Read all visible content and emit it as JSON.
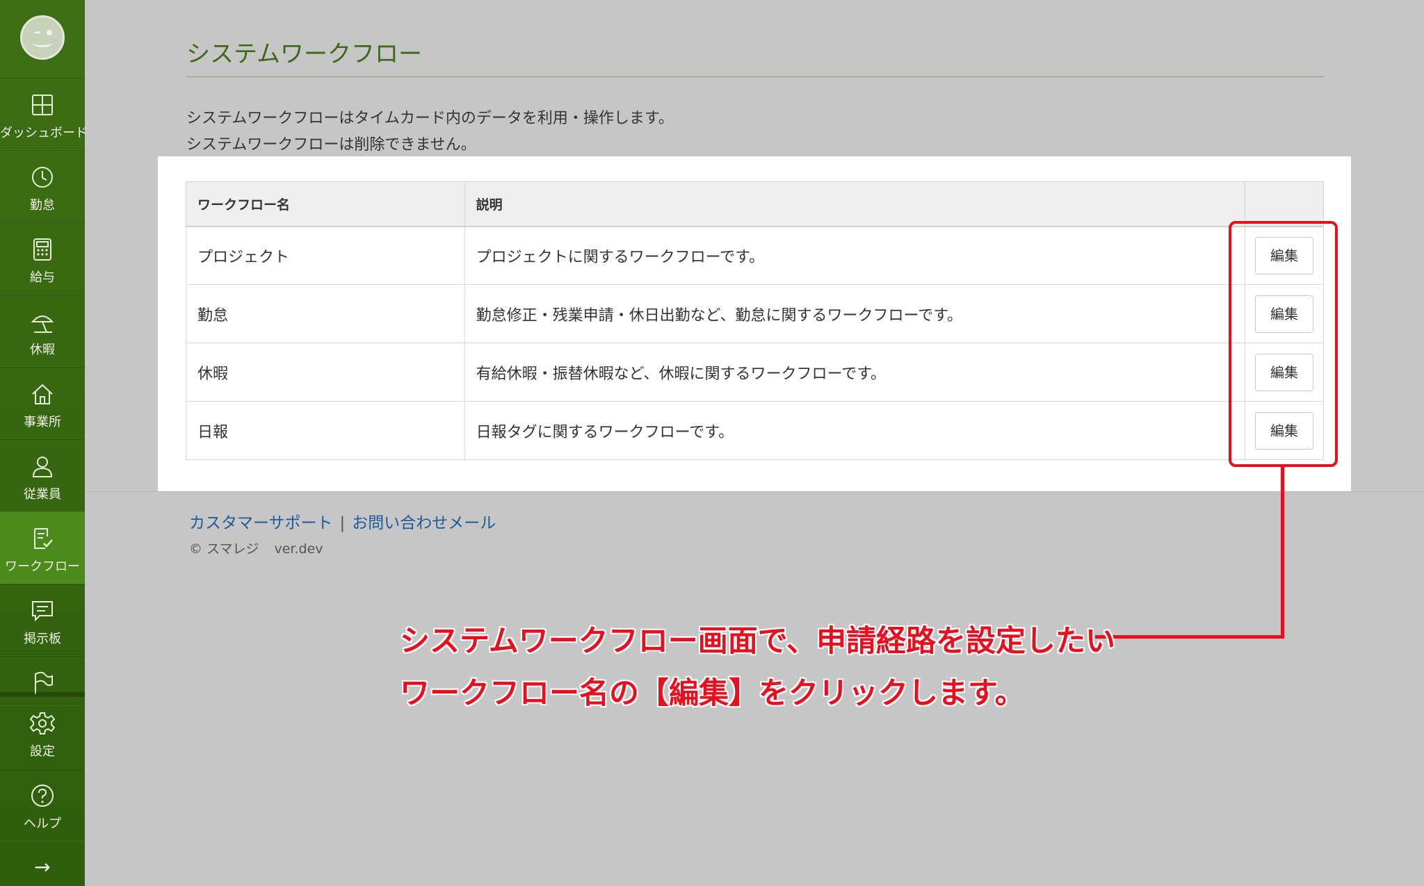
{
  "sidebar": {
    "items": [
      {
        "label": "ダッシュボード",
        "icon": "dashboard-icon"
      },
      {
        "label": "勤怠",
        "icon": "clock-icon"
      },
      {
        "label": "給与",
        "icon": "calculator-icon"
      },
      {
        "label": "休暇",
        "icon": "beach-umbrella-icon"
      },
      {
        "label": "事業所",
        "icon": "home-icon"
      },
      {
        "label": "従業員",
        "icon": "person-icon"
      },
      {
        "label": "ワークフロー",
        "icon": "workflow-icon",
        "active": true
      },
      {
        "label": "掲示板",
        "icon": "chat-icon"
      },
      {
        "label": "",
        "icon": "flag-icon"
      }
    ],
    "bottom_items": [
      {
        "label": "設定",
        "icon": "gear-icon"
      },
      {
        "label": "ヘルプ",
        "icon": "help-icon"
      }
    ],
    "expand_arrow": "→"
  },
  "page": {
    "title": "システムワークフロー",
    "description_1": "システムワークフローはタイムカード内のデータを利用・操作します。",
    "description_2": "システムワークフローは削除できません。"
  },
  "table": {
    "headers": [
      "ワークフロー名",
      "説明",
      ""
    ],
    "rows": [
      {
        "name": "プロジェクト",
        "description": "プロジェクトに関するワークフローです。",
        "action": "編集"
      },
      {
        "name": "勤怠",
        "description": "勤怠修正・残業申請・休日出勤など、勤怠に関するワークフローです。",
        "action": "編集"
      },
      {
        "name": "休暇",
        "description": "有給休暇・振替休暇など、休暇に関するワークフローです。",
        "action": "編集"
      },
      {
        "name": "日報",
        "description": "日報タグに関するワークフローです。",
        "action": "編集"
      }
    ]
  },
  "footer": {
    "support_link": "カスタマーサポート",
    "separator": "|",
    "contact_link": "お問い合わせメール",
    "copyright": "© スマレジ",
    "version": "ver.dev"
  },
  "annotation": {
    "line_1": "システムワークフロー画面で、申請経路を設定したい",
    "line_2": "ワークフロー名の【編集】をクリックします。",
    "color": "#e8101e"
  },
  "colors": {
    "sidebar": "#2f5e0c",
    "sidebar_active": "#4d8a1c",
    "title": "#3d6a1a",
    "link": "#1e5a9a",
    "background": "#c6c6c6"
  }
}
